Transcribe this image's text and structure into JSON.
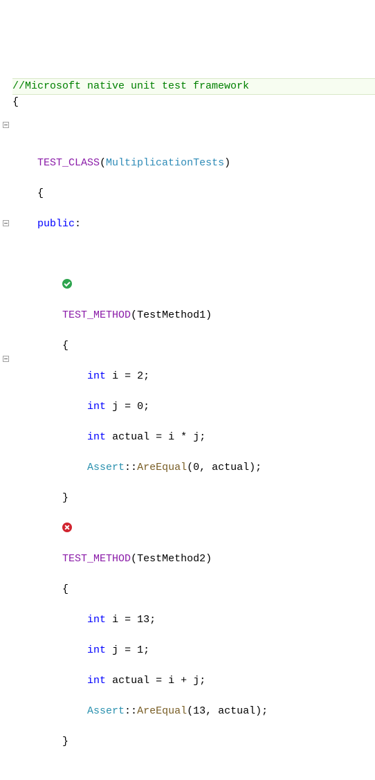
{
  "file_comment": "//Microsoft native unit test framework",
  "open_brace": "{",
  "indent1": "    ",
  "indent2": "        ",
  "indent3": "            ",
  "test_class_macro": "TEST_CLASS",
  "test_class_name": "MultiplicationTests",
  "close_paren": ")",
  "open_paren": "(",
  "brace_open": "{",
  "brace_close": "}",
  "public_kw": "public",
  "colon": ":",
  "test_method_macro": "TEST_METHOD",
  "methods": [
    {
      "status": "pass",
      "name": "TestMethod1",
      "body": [
        {
          "kw": "int",
          "ident": "i",
          "eq": "=",
          "val": "2",
          "semi": ";"
        },
        {
          "kw": "int",
          "ident": "j",
          "eq": "=",
          "val": "0",
          "semi": ";"
        },
        {
          "kw": "int",
          "ident": "actual",
          "eq": "=",
          "expr_l": "i",
          "op": "*",
          "expr_r": "j",
          "semi": ";"
        },
        {
          "cls": "Assert",
          "dcolon": "::",
          "fn": "AreEqual",
          "arg0": "0",
          "comma": ", ",
          "arg1": "actual",
          "close": ");"
        }
      ]
    },
    {
      "status": "fail",
      "name": "TestMethod2",
      "body": [
        {
          "kw": "int",
          "ident": "i",
          "eq": "=",
          "val": "13",
          "semi": ";"
        },
        {
          "kw": "int",
          "ident": "j",
          "eq": "=",
          "val": "1",
          "semi": ";"
        },
        {
          "kw": "int",
          "ident": "actual",
          "eq": "=",
          "expr_l": "i",
          "op": "+",
          "expr_r": "j",
          "semi": ";"
        },
        {
          "cls": "Assert",
          "dcolon": "::",
          "fn": "AreEqual",
          "arg0": "13",
          "comma": ", ",
          "arg1": "actual",
          "close": ");"
        }
      ]
    }
  ]
}
